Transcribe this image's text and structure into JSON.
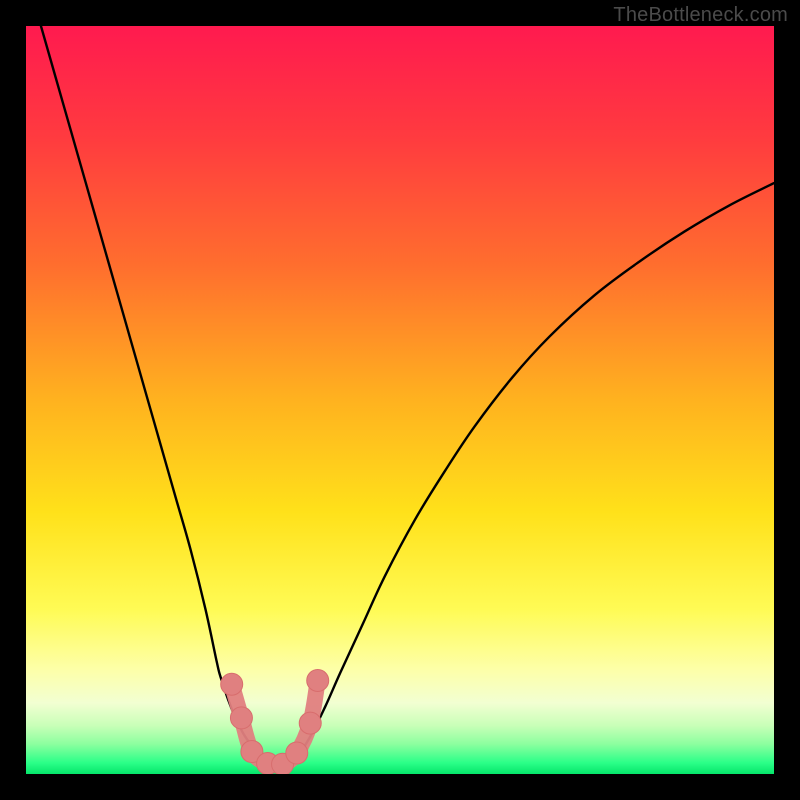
{
  "attribution": "TheBottleneck.com",
  "colors": {
    "frame": "#000000",
    "curve": "#000000",
    "marker_fill": "#e08080",
    "marker_stroke": "#d86d6d",
    "gradient_stops": [
      {
        "offset": 0.0,
        "color": "#ff1a4f"
      },
      {
        "offset": 0.15,
        "color": "#ff3b3f"
      },
      {
        "offset": 0.32,
        "color": "#ff6e2e"
      },
      {
        "offset": 0.5,
        "color": "#ffb21f"
      },
      {
        "offset": 0.65,
        "color": "#ffe11a"
      },
      {
        "offset": 0.78,
        "color": "#fffb55"
      },
      {
        "offset": 0.86,
        "color": "#fdffa8"
      },
      {
        "offset": 0.905,
        "color": "#f2ffd2"
      },
      {
        "offset": 0.935,
        "color": "#c9ffb8"
      },
      {
        "offset": 0.96,
        "color": "#8cff9f"
      },
      {
        "offset": 0.985,
        "color": "#2bff88"
      },
      {
        "offset": 1.0,
        "color": "#05e56a"
      }
    ]
  },
  "chart_data": {
    "type": "line",
    "title": "",
    "xlabel": "",
    "ylabel": "",
    "xlim": [
      0,
      100
    ],
    "ylim": [
      0,
      100
    ],
    "series": [
      {
        "name": "left-curve",
        "x": [
          2,
          4,
          6,
          8,
          10,
          12,
          14,
          16,
          18,
          20,
          22,
          24,
          25.5,
          26,
          27,
          28,
          29,
          30,
          31,
          32,
          33,
          34
        ],
        "y": [
          100,
          93,
          86,
          79,
          72,
          65,
          58,
          51,
          44,
          37,
          30,
          22,
          15,
          13,
          10,
          7.5,
          5.5,
          4.0,
          2.8,
          1.8,
          1.0,
          0.5
        ]
      },
      {
        "name": "right-curve",
        "x": [
          34,
          36,
          38,
          40,
          42,
          45,
          48,
          52,
          56,
          60,
          65,
          70,
          76,
          82,
          88,
          94,
          100
        ],
        "y": [
          0.5,
          2.0,
          5.0,
          9.0,
          13.5,
          20.0,
          26.5,
          34.0,
          40.5,
          46.5,
          53.0,
          58.5,
          64.0,
          68.5,
          72.5,
          76.0,
          79.0
        ]
      }
    ],
    "markers": {
      "name": "highlight",
      "points": [
        {
          "x": 27.5,
          "y": 12.0
        },
        {
          "x": 28.8,
          "y": 7.5
        },
        {
          "x": 30.2,
          "y": 3.0
        },
        {
          "x": 32.3,
          "y": 1.4
        },
        {
          "x": 34.3,
          "y": 1.3
        },
        {
          "x": 36.2,
          "y": 2.8
        },
        {
          "x": 38.0,
          "y": 6.8
        },
        {
          "x": 39.0,
          "y": 12.5
        }
      ],
      "connected": true
    }
  }
}
